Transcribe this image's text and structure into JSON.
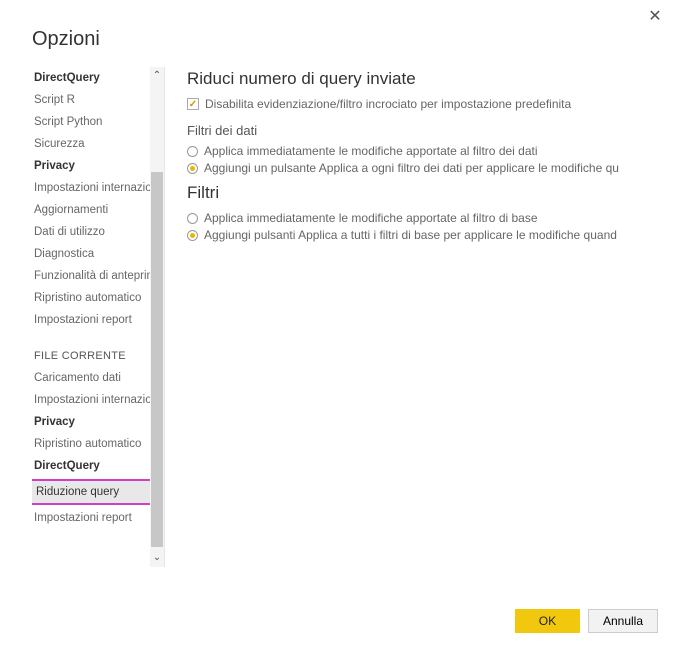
{
  "dialog": {
    "title": "Opzioni"
  },
  "sidebar": {
    "global": [
      {
        "label": "DirectQuery",
        "bold": true
      },
      {
        "label": "Script R"
      },
      {
        "label": "Script Python"
      },
      {
        "label": "Sicurezza"
      },
      {
        "label": "Privacy",
        "bold": true
      },
      {
        "label": "Impostazioni internazionali"
      },
      {
        "label": "Aggiornamenti"
      },
      {
        "label": "Dati di utilizzo"
      },
      {
        "label": "Diagnostica"
      },
      {
        "label": "Funzionalità di anteprima"
      },
      {
        "label": "Ripristino automatico"
      },
      {
        "label": "Impostazioni report"
      }
    ],
    "file_header": "FILE CORRENTE",
    "file": [
      {
        "label": "Caricamento dati"
      },
      {
        "label": "Impostazioni internazionali"
      },
      {
        "label": "Privacy",
        "bold": true
      },
      {
        "label": "Ripristino automatico"
      },
      {
        "label": "DirectQuery",
        "bold": true
      },
      {
        "label": "Riduzione query",
        "selected": true
      },
      {
        "label": "Impostazioni report"
      }
    ]
  },
  "main": {
    "h1": "Riduci numero di query inviate",
    "cb1": "Disabilita evidenziazione/filtro incrociato per impostazione predefinita",
    "h2a": "Filtri dei dati",
    "r1a": "Applica immediatamente le modifiche apportate al filtro dei dati",
    "r1b": "Aggiungi un pulsante Applica a ogni filtro dei dati per applicare le modifiche qu",
    "h2b": "Filtri",
    "r2a": "Applica immediatamente le modifiche apportate al filtro di base",
    "r2b": "Aggiungi pulsanti Applica a tutti i filtri di base per applicare le modifiche quand"
  },
  "footer": {
    "ok": "OK",
    "cancel": "Annulla"
  }
}
